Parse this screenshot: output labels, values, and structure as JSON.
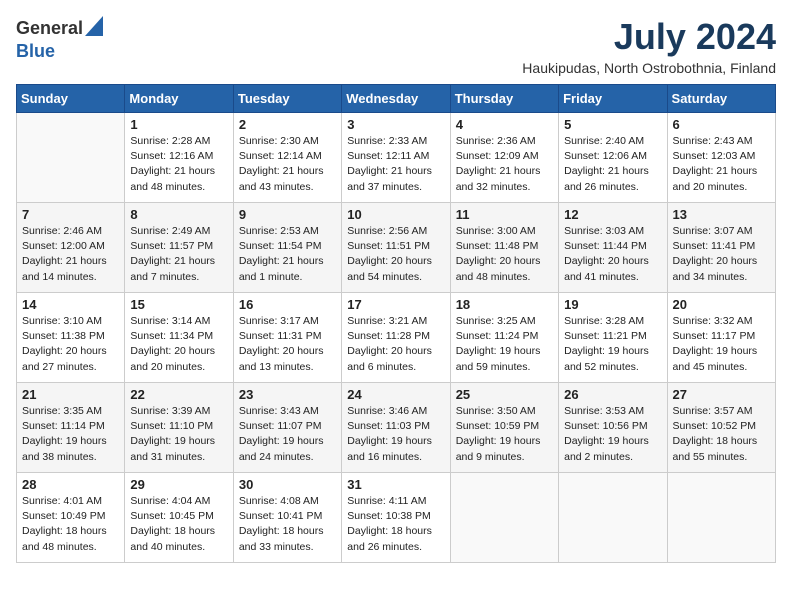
{
  "header": {
    "logo_general": "General",
    "logo_blue": "Blue",
    "month_year": "July 2024",
    "location": "Haukipudas, North Ostrobothnia, Finland"
  },
  "weekdays": [
    "Sunday",
    "Monday",
    "Tuesday",
    "Wednesday",
    "Thursday",
    "Friday",
    "Saturday"
  ],
  "weeks": [
    [
      {
        "day": "",
        "text": ""
      },
      {
        "day": "1",
        "text": "Sunrise: 2:28 AM\nSunset: 12:16 AM\nDaylight: 21 hours\nand 48 minutes."
      },
      {
        "day": "2",
        "text": "Sunrise: 2:30 AM\nSunset: 12:14 AM\nDaylight: 21 hours\nand 43 minutes."
      },
      {
        "day": "3",
        "text": "Sunrise: 2:33 AM\nSunset: 12:11 AM\nDaylight: 21 hours\nand 37 minutes."
      },
      {
        "day": "4",
        "text": "Sunrise: 2:36 AM\nSunset: 12:09 AM\nDaylight: 21 hours\nand 32 minutes."
      },
      {
        "day": "5",
        "text": "Sunrise: 2:40 AM\nSunset: 12:06 AM\nDaylight: 21 hours\nand 26 minutes."
      },
      {
        "day": "6",
        "text": "Sunrise: 2:43 AM\nSunset: 12:03 AM\nDaylight: 21 hours\nand 20 minutes."
      }
    ],
    [
      {
        "day": "7",
        "text": "Sunrise: 2:46 AM\nSunset: 12:00 AM\nDaylight: 21 hours\nand 14 minutes."
      },
      {
        "day": "8",
        "text": "Sunrise: 2:49 AM\nSunset: 11:57 PM\nDaylight: 21 hours\nand 7 minutes."
      },
      {
        "day": "9",
        "text": "Sunrise: 2:53 AM\nSunset: 11:54 PM\nDaylight: 21 hours\nand 1 minute."
      },
      {
        "day": "10",
        "text": "Sunrise: 2:56 AM\nSunset: 11:51 PM\nDaylight: 20 hours\nand 54 minutes."
      },
      {
        "day": "11",
        "text": "Sunrise: 3:00 AM\nSunset: 11:48 PM\nDaylight: 20 hours\nand 48 minutes."
      },
      {
        "day": "12",
        "text": "Sunrise: 3:03 AM\nSunset: 11:44 PM\nDaylight: 20 hours\nand 41 minutes."
      },
      {
        "day": "13",
        "text": "Sunrise: 3:07 AM\nSunset: 11:41 PM\nDaylight: 20 hours\nand 34 minutes."
      }
    ],
    [
      {
        "day": "14",
        "text": "Sunrise: 3:10 AM\nSunset: 11:38 PM\nDaylight: 20 hours\nand 27 minutes."
      },
      {
        "day": "15",
        "text": "Sunrise: 3:14 AM\nSunset: 11:34 PM\nDaylight: 20 hours\nand 20 minutes."
      },
      {
        "day": "16",
        "text": "Sunrise: 3:17 AM\nSunset: 11:31 PM\nDaylight: 20 hours\nand 13 minutes."
      },
      {
        "day": "17",
        "text": "Sunrise: 3:21 AM\nSunset: 11:28 PM\nDaylight: 20 hours\nand 6 minutes."
      },
      {
        "day": "18",
        "text": "Sunrise: 3:25 AM\nSunset: 11:24 PM\nDaylight: 19 hours\nand 59 minutes."
      },
      {
        "day": "19",
        "text": "Sunrise: 3:28 AM\nSunset: 11:21 PM\nDaylight: 19 hours\nand 52 minutes."
      },
      {
        "day": "20",
        "text": "Sunrise: 3:32 AM\nSunset: 11:17 PM\nDaylight: 19 hours\nand 45 minutes."
      }
    ],
    [
      {
        "day": "21",
        "text": "Sunrise: 3:35 AM\nSunset: 11:14 PM\nDaylight: 19 hours\nand 38 minutes."
      },
      {
        "day": "22",
        "text": "Sunrise: 3:39 AM\nSunset: 11:10 PM\nDaylight: 19 hours\nand 31 minutes."
      },
      {
        "day": "23",
        "text": "Sunrise: 3:43 AM\nSunset: 11:07 PM\nDaylight: 19 hours\nand 24 minutes."
      },
      {
        "day": "24",
        "text": "Sunrise: 3:46 AM\nSunset: 11:03 PM\nDaylight: 19 hours\nand 16 minutes."
      },
      {
        "day": "25",
        "text": "Sunrise: 3:50 AM\nSunset: 10:59 PM\nDaylight: 19 hours\nand 9 minutes."
      },
      {
        "day": "26",
        "text": "Sunrise: 3:53 AM\nSunset: 10:56 PM\nDaylight: 19 hours\nand 2 minutes."
      },
      {
        "day": "27",
        "text": "Sunrise: 3:57 AM\nSunset: 10:52 PM\nDaylight: 18 hours\nand 55 minutes."
      }
    ],
    [
      {
        "day": "28",
        "text": "Sunrise: 4:01 AM\nSunset: 10:49 PM\nDaylight: 18 hours\nand 48 minutes."
      },
      {
        "day": "29",
        "text": "Sunrise: 4:04 AM\nSunset: 10:45 PM\nDaylight: 18 hours\nand 40 minutes."
      },
      {
        "day": "30",
        "text": "Sunrise: 4:08 AM\nSunset: 10:41 PM\nDaylight: 18 hours\nand 33 minutes."
      },
      {
        "day": "31",
        "text": "Sunrise: 4:11 AM\nSunset: 10:38 PM\nDaylight: 18 hours\nand 26 minutes."
      },
      {
        "day": "",
        "text": ""
      },
      {
        "day": "",
        "text": ""
      },
      {
        "day": "",
        "text": ""
      }
    ]
  ]
}
